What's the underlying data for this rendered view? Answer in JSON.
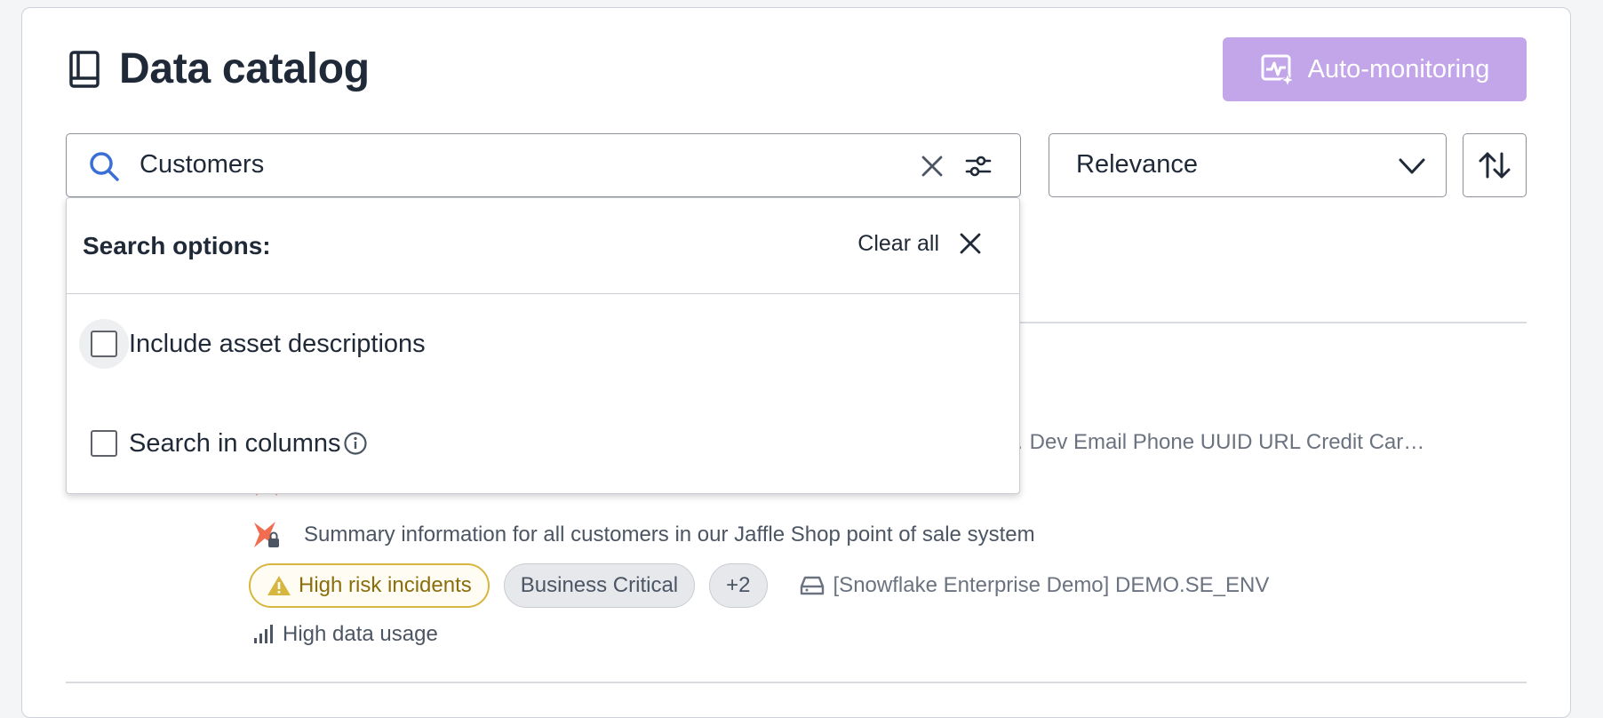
{
  "page": {
    "title": "Data catalog",
    "auto_monitoring_label": "Auto-monitoring"
  },
  "search": {
    "value": "Customers"
  },
  "sort": {
    "selected": "Relevance"
  },
  "search_options": {
    "title": "Search options:",
    "clear_all_label": "Clear all",
    "options": [
      {
        "label": "Include asset descriptions",
        "checked": false
      },
      {
        "label": "Search in columns",
        "checked": false
      }
    ]
  },
  "result": {
    "columns_partial": "… Dev Email Phone UUID URL Credit Car…",
    "description": "Summary information for all customers in our Jaffle Shop point of sale system",
    "tags": {
      "risk_label": "High risk incidents",
      "business_label": "Business Critical",
      "more_label": "+2"
    },
    "source": "[Snowflake Enterprise Demo] DEMO.SE_ENV",
    "usage": "High data usage"
  },
  "colors": {
    "accent_purple": "#c3a6e9",
    "search_icon_blue": "#3b6fd8",
    "risk_border": "#d7b640",
    "risk_text": "#8a6d0c",
    "dbt_orange": "#f26c4f"
  }
}
